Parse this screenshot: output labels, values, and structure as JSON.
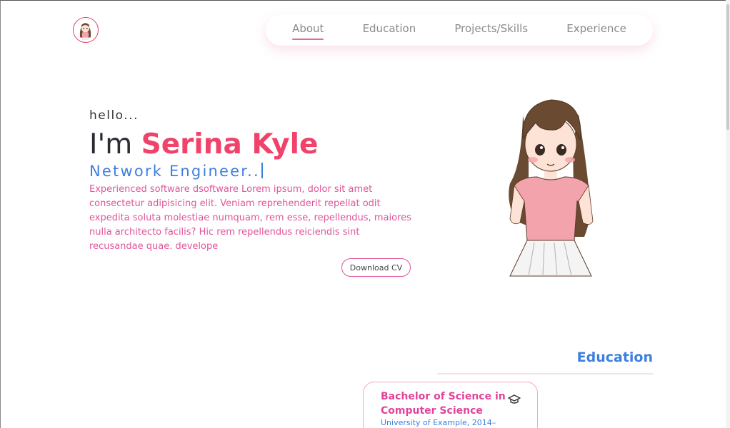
{
  "nav": {
    "items": [
      {
        "label": "About",
        "active": true
      },
      {
        "label": "Education",
        "active": false
      },
      {
        "label": "Projects/Skills",
        "active": false
      },
      {
        "label": "Experience",
        "active": false
      }
    ]
  },
  "hero": {
    "greeting": "hello...",
    "intro": "I'm ",
    "name": "Serina Kyle",
    "role": "Network Engineer..",
    "bio": "Experienced software dsoftware Lorem ipsum, dolor sit amet consectetur adipisicing elit. Veniam reprehenderit repellat odit expedita soluta molestiae numquam, rem esse, repellendus, maiores nulla architecto facilis? Hic rem repellendus reiciendis sint recusandae quae. develope",
    "download_label": "Download CV"
  },
  "education": {
    "title": "Education",
    "cards": [
      {
        "degree": "Bachelor of Science in Computer Science",
        "school": "University of Example, 2014–"
      }
    ]
  },
  "colors": {
    "accent_pink": "#f0426a",
    "accent_blue": "#3d7fe0",
    "text_pink": "#e0559a"
  },
  "icons": {
    "logo": "avatar-icon",
    "degree": "graduation-cap-icon"
  }
}
